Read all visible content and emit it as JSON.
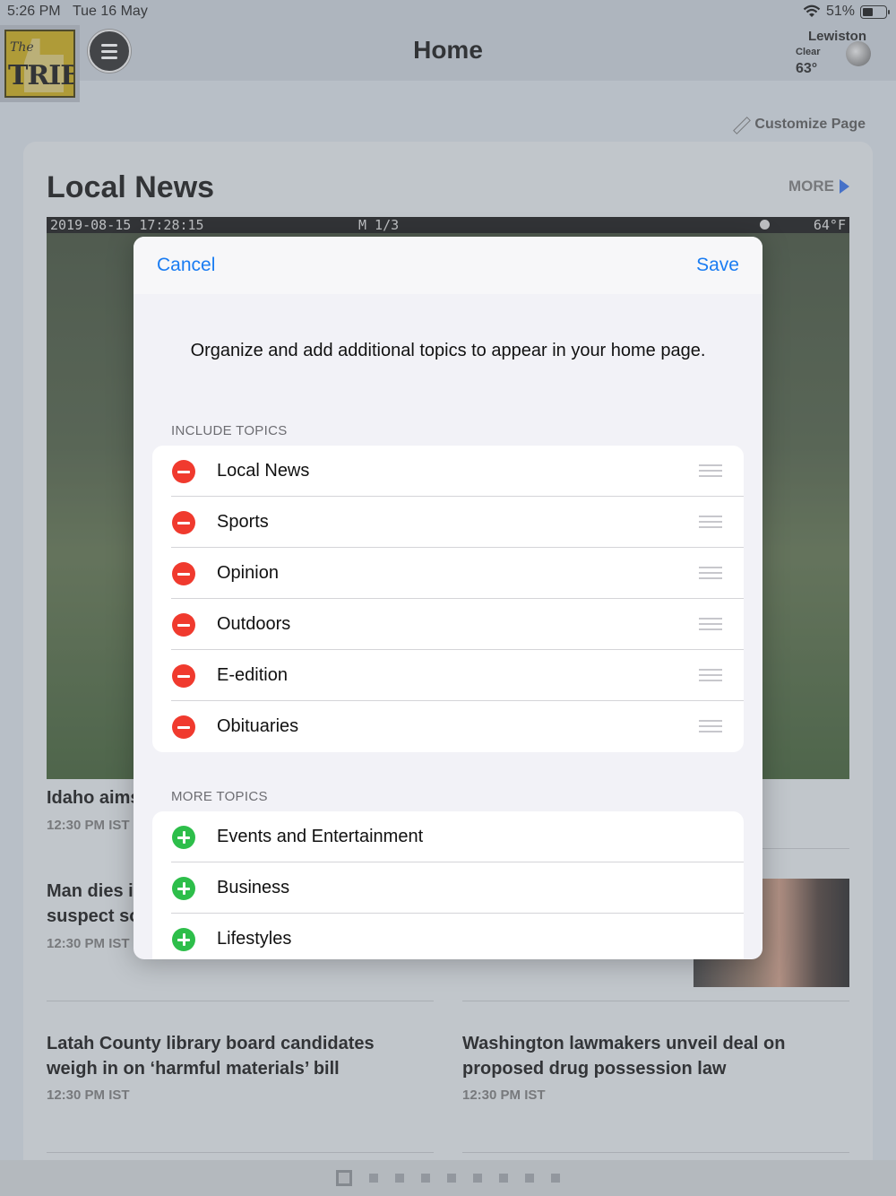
{
  "status_bar": {
    "time": "5:26 PM",
    "date": "Tue 16 May",
    "battery": "51%",
    "battery_fraction": 0.51
  },
  "header": {
    "logo_text_top": "The",
    "logo_text_main": "TRIB",
    "title": "Home",
    "weather": {
      "city": "Lewiston",
      "condition": "Clear",
      "temp": "63°"
    }
  },
  "customize_label": "Customize Page",
  "section": {
    "title": "Local News",
    "more_label": "MORE"
  },
  "photo_stamp": {
    "datetime": "2019-08-15 17:28:15",
    "mode": "M 1/3",
    "temp": "64°F"
  },
  "stories": [
    {
      "title": "Idaho aims",
      "time": "12:30 PM IST"
    },
    {
      "title_line1": "Man dies i",
      "title_line2": "suspect so",
      "time": "12:30 PM IST"
    },
    {
      "title_line1": "Latah County library board candidates",
      "title_line2": "weigh in on ‘harmful materials’ bill",
      "time": "12:30 PM IST"
    },
    {
      "title_line1": "Washington lawmakers unveil deal on",
      "title_line2": "proposed drug possession law",
      "time": "12:30 PM IST"
    }
  ],
  "modal": {
    "cancel_label": "Cancel",
    "save_label": "Save",
    "intro": "Organize and add additional topics to appear in your home page.",
    "include_header": "INCLUDE TOPICS",
    "include_topics": [
      "Local News",
      "Sports",
      "Opinion",
      "Outdoors",
      "E-edition",
      "Obituaries"
    ],
    "more_header": "MORE TOPICS",
    "more_topics": [
      "Events and Entertainment",
      "Business",
      "Lifestyles"
    ]
  },
  "pager": {
    "count": 9,
    "active_index": 0
  }
}
